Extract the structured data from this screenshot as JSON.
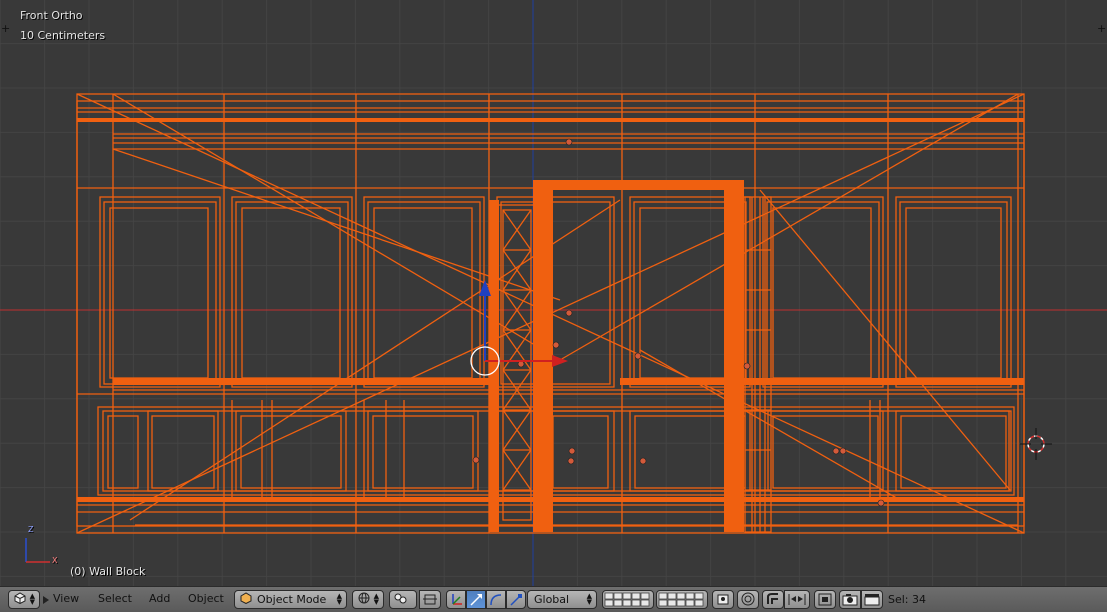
{
  "viewport": {
    "view_name": "Front Ortho",
    "grid_scale": "10 Centimeters",
    "active_object": "(0) Wall Block",
    "axis_z": "Z",
    "axis_x": "X"
  },
  "header": {
    "editor_type_icon": "3d-view-icon",
    "menus": [
      "View",
      "Select",
      "Add",
      "Object"
    ],
    "mode": "Object Mode",
    "orientation": "Global",
    "selection_status": "Sel: 34"
  },
  "colors": {
    "background": "#393939",
    "grid": "#444444",
    "selected_wire": "#f06010",
    "x_axis": "#c03030",
    "y_axis": "#2040a0"
  }
}
